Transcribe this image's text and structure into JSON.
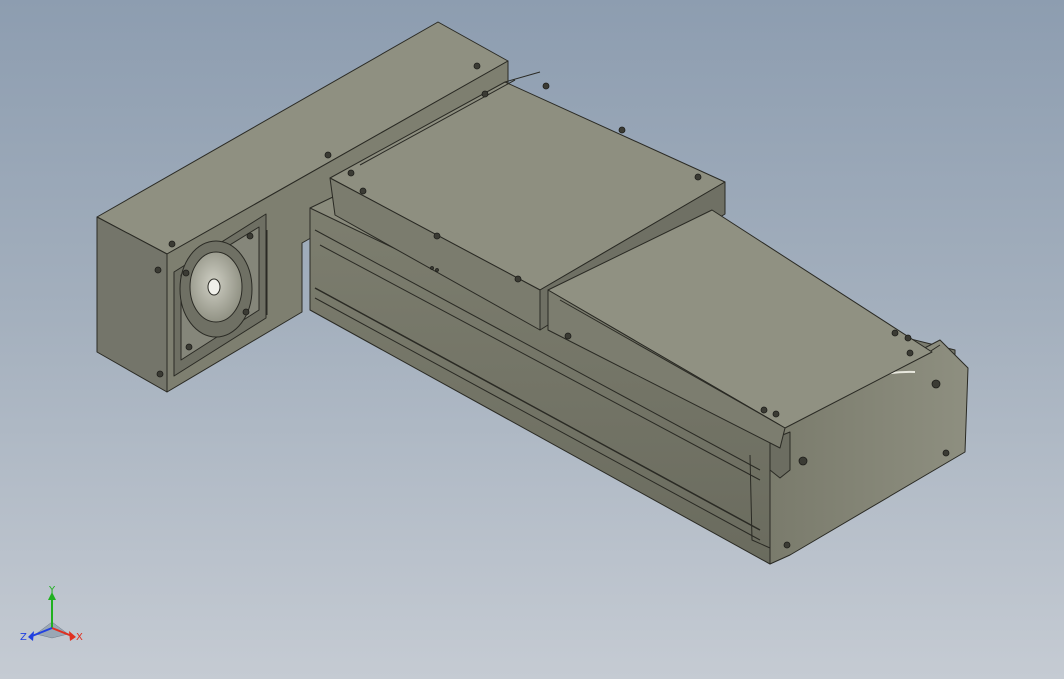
{
  "viewport": {
    "background_top": "#8d9db0",
    "background_bottom": "#c5cbd3",
    "part_color": "#8a8a7a",
    "edge_color": "#2a2a24"
  },
  "triad": {
    "x_label": "X",
    "y_label": "Y",
    "z_label": "Z",
    "x_color": "#e03020",
    "y_color": "#20b020",
    "z_color": "#2040e0"
  }
}
